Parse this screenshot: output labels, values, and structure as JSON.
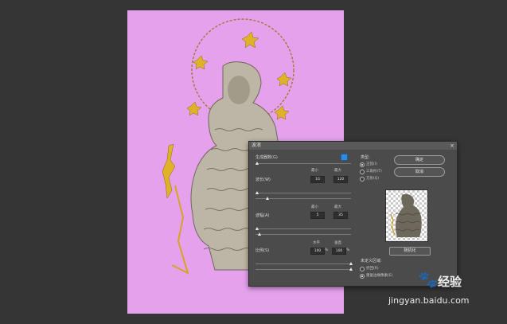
{
  "dialog": {
    "title": "波浪",
    "close": "×",
    "generators_label": "生成器数(G)",
    "wavelength_label": "波长(W)",
    "amplitude_label": "波幅(A)",
    "scale_label": "比例(S)",
    "min_label": "最小",
    "max_label": "最大",
    "horizontal_label": "水平",
    "vertical_label": "垂直",
    "wavelength_min": "10",
    "wavelength_max": "120",
    "amplitude_min": "5",
    "amplitude_max": "35",
    "scale_h": "100",
    "scale_v": "100",
    "percent": "%",
    "type_label": "类型:",
    "type_options": [
      "正弦(I)",
      "三角形(T)",
      "方形(Q)"
    ],
    "ok_label": "确定",
    "cancel_label": "取消",
    "randomize_label": "随机化",
    "undefined_label": "未定义区域:",
    "undefined_options": [
      "折回(R)",
      "重复边缘像素(E)"
    ],
    "sliders": {
      "generators": 0.02,
      "wavelength_min": 0.02,
      "wavelength_max": 0.12,
      "amplitude_min": 0.02,
      "amplitude_max": 0.04,
      "scale_h": 1.0,
      "scale_v": 1.0
    }
  },
  "watermark": {
    "logo": "paw-icon",
    "brand": "经验",
    "url": "jingyan.baidu.com"
  },
  "colors": {
    "canvas_bg": "#e6a1ed",
    "workspace": "#353535",
    "dialog_bg": "#4b4b4b",
    "accent": "#2f8ae0"
  }
}
